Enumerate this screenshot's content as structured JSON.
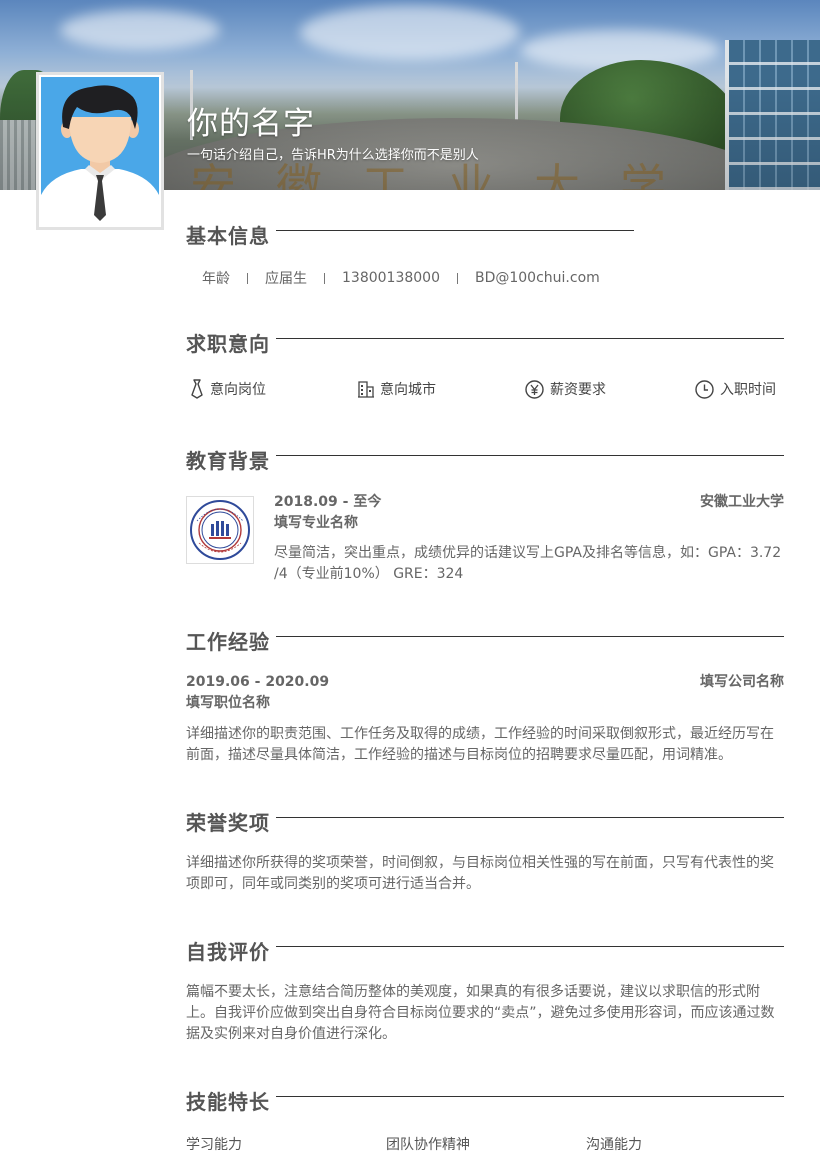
{
  "header": {
    "name": "你的名字",
    "tagline": "一句话介绍自己，告诉HR为什么选择你而不是别人"
  },
  "basic_info": {
    "title": "基本信息",
    "items": [
      "年龄",
      "应届生",
      "13800138000",
      "BD@100chui.com"
    ]
  },
  "job_intent": {
    "title": "求职意向",
    "items": [
      {
        "label": "意向岗位",
        "icon": "tie-icon"
      },
      {
        "label": "意向城市",
        "icon": "building-icon"
      },
      {
        "label": "薪资要求",
        "icon": "yen-icon"
      },
      {
        "label": "入职时间",
        "icon": "clock-icon"
      }
    ]
  },
  "education": {
    "title": "教育背景",
    "period": "2018.09 - 至今",
    "school": "安徽工业大学",
    "major": "填写专业名称",
    "description": "尽量简洁，突出重点，成绩优异的话建议写上GPA及排名等信息，如：GPA：3.72 /4（专业前10%） GRE：324"
  },
  "work": {
    "title": "工作经验",
    "period": "2019.06 - 2020.09",
    "company": "填写公司名称",
    "position": "填写职位名称",
    "description": "详细描述你的职责范围、工作任务及取得的成绩，工作经验的时间采取倒叙形式，最近经历写在前面，描述尽量具体简洁，工作经验的描述与目标岗位的招聘要求尽量匹配，用词精准。"
  },
  "honors": {
    "title": "荣誉奖项",
    "description": "详细描述你所获得的奖项荣誉，时间倒叙，与目标岗位相关性强的写在前面，只写有代表性的奖项即可，同年或同类别的奖项可进行适当合并。"
  },
  "self_eval": {
    "title": "自我评价",
    "description": "篇幅不要太长，注意结合简历整体的美观度，如果真的有很多话要说，建议以求职信的形式附上。自我评价应做到突出自身符合目标岗位要求的“卖点”，避免过多使用形容词，而应该通过数据及实例来对自身价值进行深化。"
  },
  "skills": {
    "title": "技能特长",
    "items": [
      "学习能力",
      "团队协作精神",
      "沟通能力"
    ]
  },
  "colors": {
    "accent": "#555555",
    "avatar_bg": "#4aa7e8",
    "rule": "#333333"
  }
}
